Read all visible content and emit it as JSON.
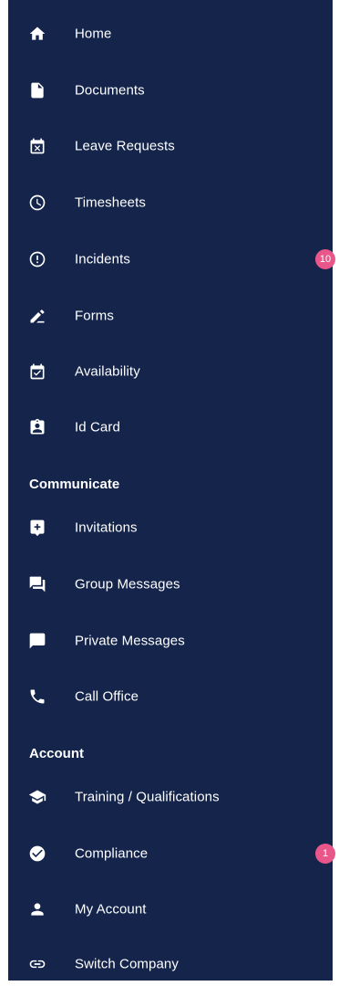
{
  "colors": {
    "drawer_bg": "#14244b",
    "text": "#ffffff",
    "badge": "#e8568a"
  },
  "menu": {
    "home": {
      "label": "Home",
      "icon": "home-icon"
    },
    "documents": {
      "label": "Documents",
      "icon": "document-icon"
    },
    "leave_requests": {
      "label": "Leave Requests",
      "icon": "calendar-x-icon"
    },
    "timesheets": {
      "label": "Timesheets",
      "icon": "clock-icon"
    },
    "incidents": {
      "label": "Incidents",
      "icon": "alert-circle-icon",
      "badge": "10"
    },
    "forms": {
      "label": "Forms",
      "icon": "pen-icon"
    },
    "availability": {
      "label": "Availability",
      "icon": "calendar-check-icon"
    },
    "id_card": {
      "label": "Id Card",
      "icon": "id-badge-icon"
    }
  },
  "communicate": {
    "heading": "Communicate",
    "invitations": {
      "label": "Invitations",
      "icon": "invite-plus-icon"
    },
    "group_messages": {
      "label": "Group Messages",
      "icon": "forum-icon"
    },
    "private_messages": {
      "label": "Private Messages",
      "icon": "message-icon"
    },
    "call_office": {
      "label": "Call Office",
      "icon": "phone-icon"
    }
  },
  "account": {
    "heading": "Account",
    "training": {
      "label": "Training / Qualifications",
      "icon": "graduation-cap-icon"
    },
    "compliance": {
      "label": "Compliance",
      "icon": "check-circle-icon",
      "badge": "1"
    },
    "my_account": {
      "label": "My Account",
      "icon": "person-icon"
    },
    "switch_company": {
      "label": "Switch Company",
      "icon": "link-icon"
    }
  }
}
